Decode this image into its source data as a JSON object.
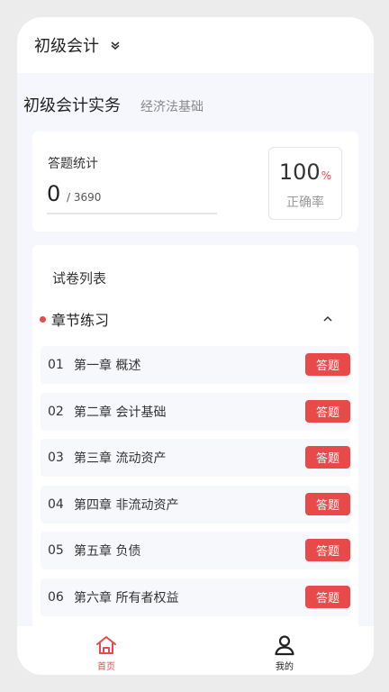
{
  "header": {
    "subject_title": "初级会计"
  },
  "tabs": [
    {
      "label": "初级会计实务",
      "active": true
    },
    {
      "label": "经济法基础",
      "active": false
    }
  ],
  "stats": {
    "label": "答题统计",
    "answered": "0",
    "total": "/ 3690",
    "progress_percent": 0,
    "rate_value": "100",
    "rate_unit": "%",
    "rate_label": "正确率"
  },
  "paper_list": {
    "title": "试卷列表",
    "section_title": "章节练习",
    "button_label": "答题",
    "chapters": [
      {
        "num": "01",
        "title": "第一章 概述"
      },
      {
        "num": "02",
        "title": "第二章 会计基础"
      },
      {
        "num": "03",
        "title": "第三章 流动资产"
      },
      {
        "num": "04",
        "title": "第四章 非流动资产"
      },
      {
        "num": "05",
        "title": "第五章 负债"
      },
      {
        "num": "06",
        "title": "第六章 所有者权益"
      }
    ]
  },
  "navbar": [
    {
      "label": "首页",
      "icon": "home-icon",
      "active": true
    },
    {
      "label": "我的",
      "icon": "user-icon",
      "active": false
    }
  ],
  "colors": {
    "accent": "#e84a4a",
    "background": "#f5f7fc"
  }
}
